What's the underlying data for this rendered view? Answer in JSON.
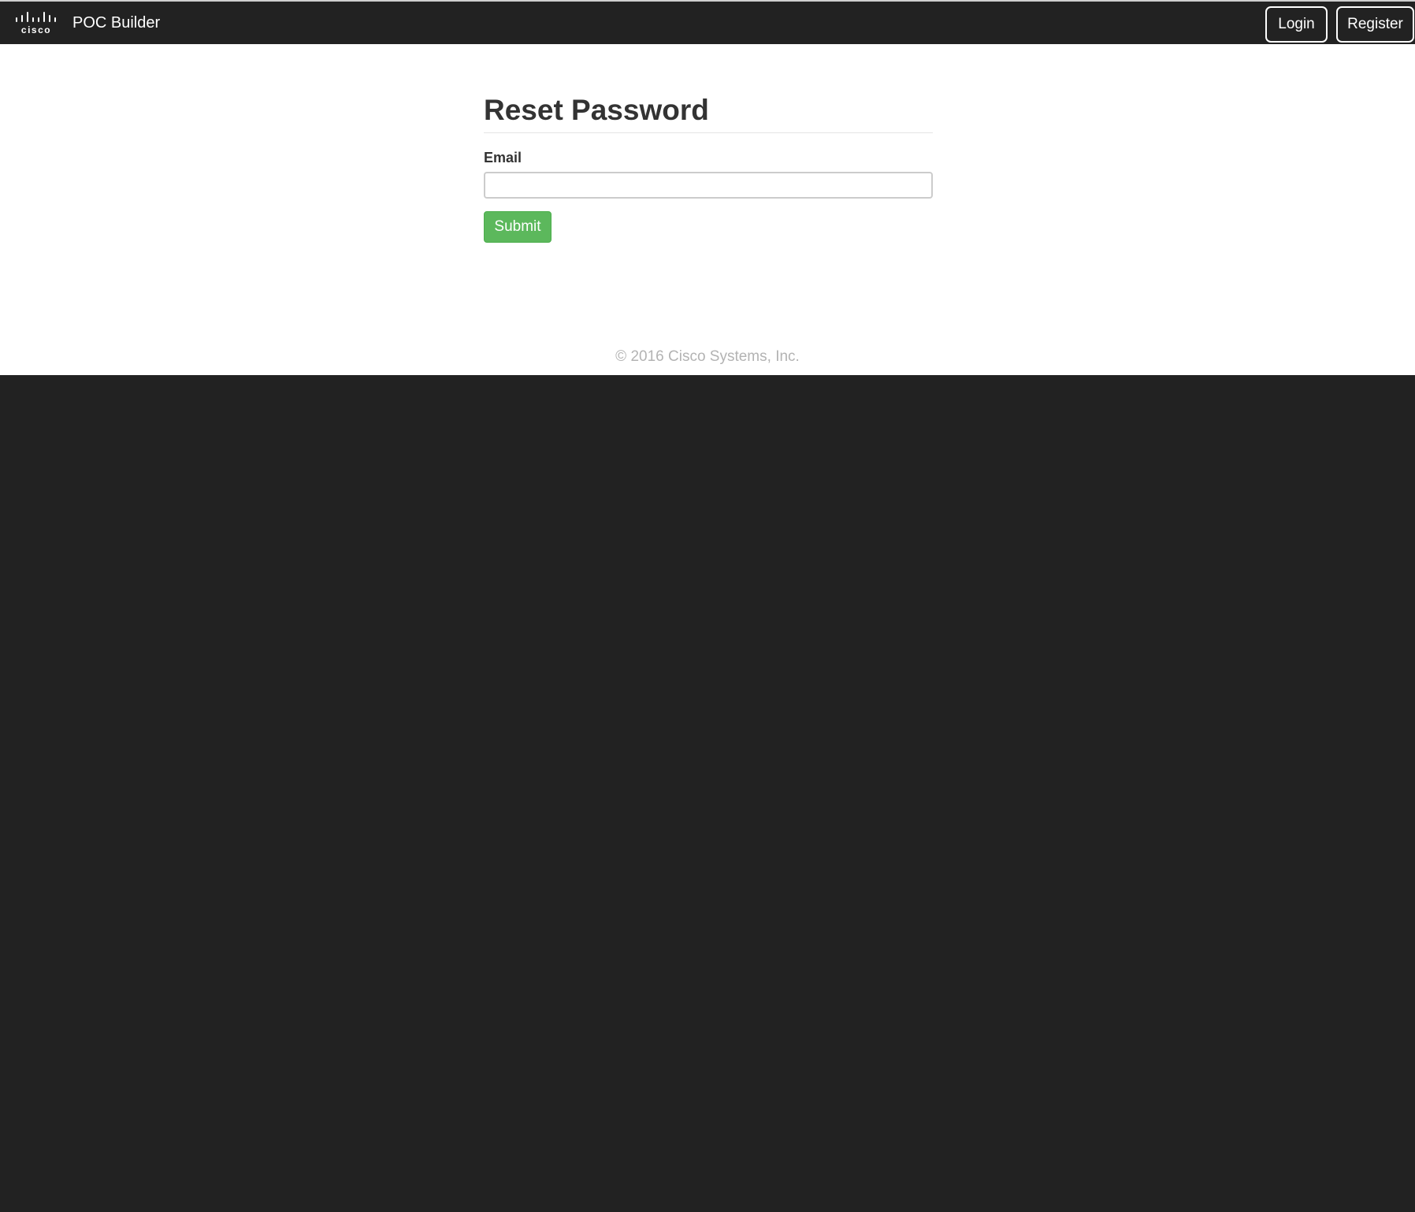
{
  "navbar": {
    "logo_text": "cisco",
    "brand": "POC Builder",
    "login_label": "Login",
    "register_label": "Register"
  },
  "main": {
    "title": "Reset Password",
    "email_label": "Email",
    "email_value": "",
    "email_placeholder": "",
    "submit_label": "Submit"
  },
  "footer": {
    "copyright": "© 2016 Cisco Systems, Inc."
  },
  "colors": {
    "navbar_bg": "#222222",
    "submit_bg": "#5cb85c",
    "text": "#333333",
    "footer_text": "#b3b3b3"
  }
}
